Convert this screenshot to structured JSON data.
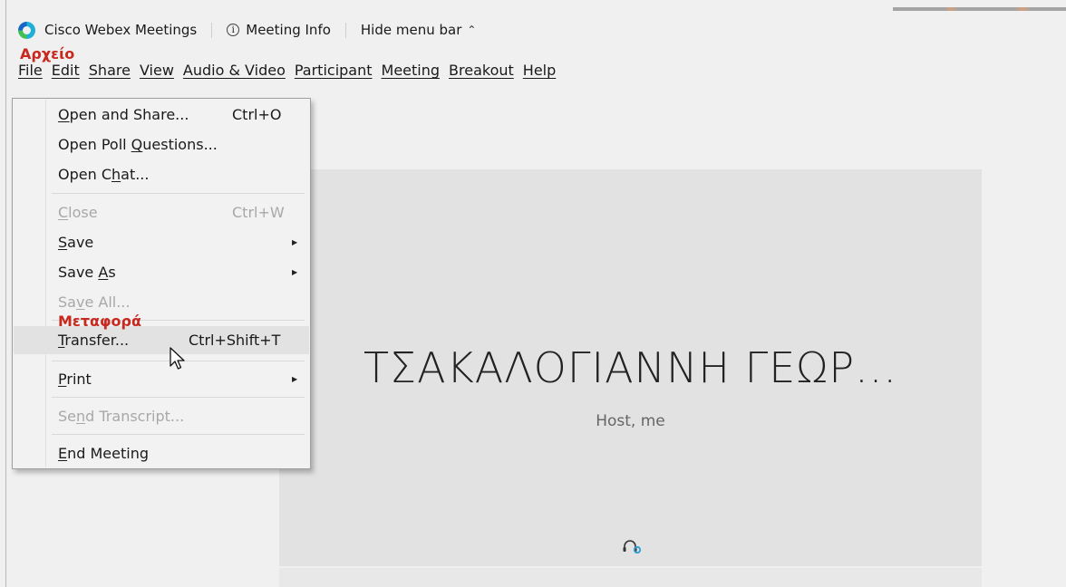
{
  "titlebar": {
    "app_name": "Cisco Webex Meetings",
    "meeting_info": "Meeting Info",
    "hide_menu": "Hide menu bar"
  },
  "annotations": {
    "file_label": "Αρχείο",
    "transfer_label": "Μεταφορά"
  },
  "menubar": [
    "File",
    "Edit",
    "Share",
    "View",
    "Audio & Video",
    "Participant",
    "Meeting",
    "Breakout",
    "Help"
  ],
  "file_menu": {
    "open_share": {
      "pre": "",
      "mn": "O",
      "post": "pen and Share...",
      "shortcut": "Ctrl+O"
    },
    "open_poll": {
      "pre": "Open Poll ",
      "mn": "Q",
      "post": "uestions..."
    },
    "open_chat": {
      "pre": "Open C",
      "mn": "h",
      "post": "at..."
    },
    "close": {
      "pre": "",
      "mn": "C",
      "post": "lose",
      "shortcut": "Ctrl+W"
    },
    "save": {
      "pre": "",
      "mn": "S",
      "post": "ave"
    },
    "save_as": {
      "pre": "Save ",
      "mn": "A",
      "post": "s"
    },
    "save_all": {
      "pre": "Sa",
      "mn": "v",
      "post": "e All..."
    },
    "transfer": {
      "pre": "",
      "mn": "T",
      "post": "ransfer...",
      "shortcut": "Ctrl+Shift+T"
    },
    "print": {
      "pre": "",
      "mn": "P",
      "post": "rint"
    },
    "send_transcript": {
      "pre": "Se",
      "mn": "n",
      "post": "d Transcript..."
    },
    "end_meeting": {
      "pre": "",
      "mn": "E",
      "post": "nd Meeting"
    }
  },
  "stage": {
    "host_name": "ΤΣΑΚΑΛΟΓΙΑΝΝΗ ΓΕΩΡ...",
    "host_role": "Host, me"
  },
  "icons": {
    "logo": "webex-logo-icon",
    "info": "info-icon",
    "chevron": "chevron-up-icon",
    "submenu": "submenu-arrow-icon",
    "headset": "headset-icon",
    "cursor": "mouse-cursor-icon"
  },
  "colors": {
    "annotation": "#c8281e",
    "stage_bg": "#e2e2e2",
    "menu_bg": "#f2f2f2"
  }
}
